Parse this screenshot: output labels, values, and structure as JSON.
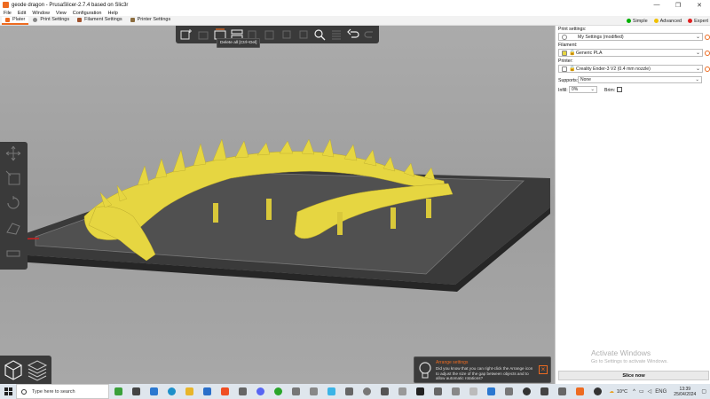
{
  "window": {
    "title": "geode dragon - PrusaSlicer-2.7.4 based on Slic3r",
    "controls": [
      "—",
      "❐",
      "✕"
    ]
  },
  "menu": [
    "File",
    "Edit",
    "Window",
    "View",
    "Configuration",
    "Help"
  ],
  "tabs": [
    {
      "label": "Plater",
      "color": "#ed6b21"
    },
    {
      "label": "Print Settings",
      "color": "#888888"
    },
    {
      "label": "Filament Settings",
      "color": "#a0522d"
    },
    {
      "label": "Printer Settings",
      "color": "#8c6d3f"
    }
  ],
  "modes": [
    {
      "label": "Simple",
      "color": "#00b000"
    },
    {
      "label": "Advanced",
      "color": "#f0c000"
    },
    {
      "label": "Expert",
      "color": "#e02020"
    }
  ],
  "toolbar": {
    "tooltip": "Delete all [Ctrl+Del]"
  },
  "sidebar": {
    "print_settings_label": "Print settings:",
    "print_settings_value": "My Settings (modified)",
    "filament_label": "Filament:",
    "filament_value": "Generic PLA",
    "printer_label": "Printer:",
    "printer_value": "Creality Ender-3 V2 (0.4 mm nozzle)",
    "supports_label": "Supports:",
    "supports_value": "None",
    "infill_label": "Infill:",
    "infill_value": "0%",
    "brim_label": "Brim:",
    "slice_label": "Slice now"
  },
  "watermark": {
    "title": "Activate Windows",
    "subtitle": "Go to Settings to activate Windows."
  },
  "notification": {
    "title": "Arrange settings",
    "body": "Did you know that you can right-click the Arrange icon to adjust the size of the gap between objects and to allow automatic rotations?"
  },
  "taskbar": {
    "search_placeholder": "Type here to search",
    "temperature": "10°C",
    "language": "ENG",
    "time": "13:39",
    "date": "25/04/2024"
  },
  "colors": {
    "accent": "#ed6b21",
    "model": "#e6d641",
    "bed": "#3b3b3b"
  }
}
